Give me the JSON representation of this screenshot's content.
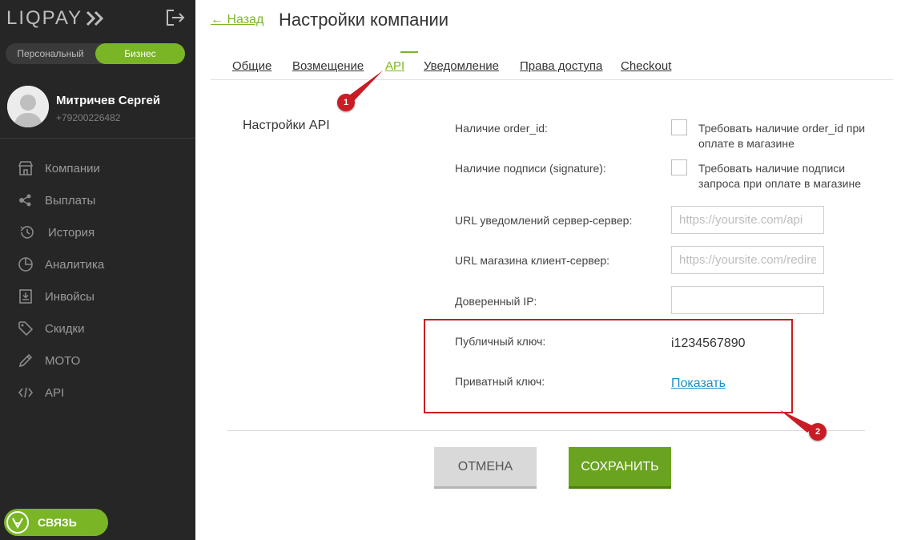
{
  "sidebar": {
    "logo_text": "LIQPAY",
    "mode_switch": {
      "personal": "Персональный",
      "business": "Бизнес",
      "active": "business"
    },
    "profile": {
      "name": "Митричев Сергей",
      "phone": "+79200226482"
    },
    "menu": [
      {
        "label": "Компании",
        "icon": "store-icon"
      },
      {
        "label": "Выплаты",
        "icon": "payouts-icon"
      },
      {
        "label": "История",
        "icon": "history-icon"
      },
      {
        "label": "Аналитика",
        "icon": "analytics-pie-icon"
      },
      {
        "label": "Инвойсы",
        "icon": "invoice-icon"
      },
      {
        "label": "Скидки",
        "icon": "discount-tag-icon"
      },
      {
        "label": "МОТО",
        "icon": "pen-icon"
      },
      {
        "label": "API",
        "icon": "code-icon"
      }
    ],
    "contact_label": "СВЯЗЬ"
  },
  "header": {
    "back_label": "← Назад",
    "title": "Настройки компании"
  },
  "tabs": [
    {
      "label": "Общие",
      "active": false
    },
    {
      "label": "Возмещение",
      "active": false
    },
    {
      "label": "API",
      "active": true
    },
    {
      "label": "Уведомление",
      "active": false
    },
    {
      "label": "Права доступа",
      "active": false
    },
    {
      "label": "Checkout",
      "active": false
    }
  ],
  "section": {
    "title": "Настройки API",
    "order_id": {
      "label": "Наличие order_id:",
      "checkbox_text": "Требовать наличие order_id при оплате в магазине",
      "checked": false
    },
    "signature": {
      "label": "Наличие подписи (signature):",
      "checkbox_text": "Требовать наличие подписи запроса при оплате в магазине",
      "checked": false
    },
    "server_url": {
      "label": "URL уведомлений сервер-сервер:",
      "value": "",
      "placeholder": "https://yoursite.com/api"
    },
    "shop_url": {
      "label": "URL магазина клиент-сервер:",
      "value": "",
      "placeholder": "https://yoursite.com/redirect"
    },
    "trusted_ip": {
      "label": "Доверенный IP:",
      "value": "",
      "placeholder": ""
    },
    "public_key": {
      "label": "Публичный ключ:",
      "value": "i1234567890"
    },
    "private_key": {
      "label": "Приватный ключ:",
      "link": "Показать"
    }
  },
  "actions": {
    "cancel": "Отмена",
    "save": "Сохранить"
  },
  "annotations": {
    "marker_1": "1",
    "marker_2": "2"
  },
  "colors": {
    "accent": "#7ab526",
    "sidebar_bg": "#262626",
    "annotation": "#c91c24",
    "link": "#1a8fc9"
  }
}
